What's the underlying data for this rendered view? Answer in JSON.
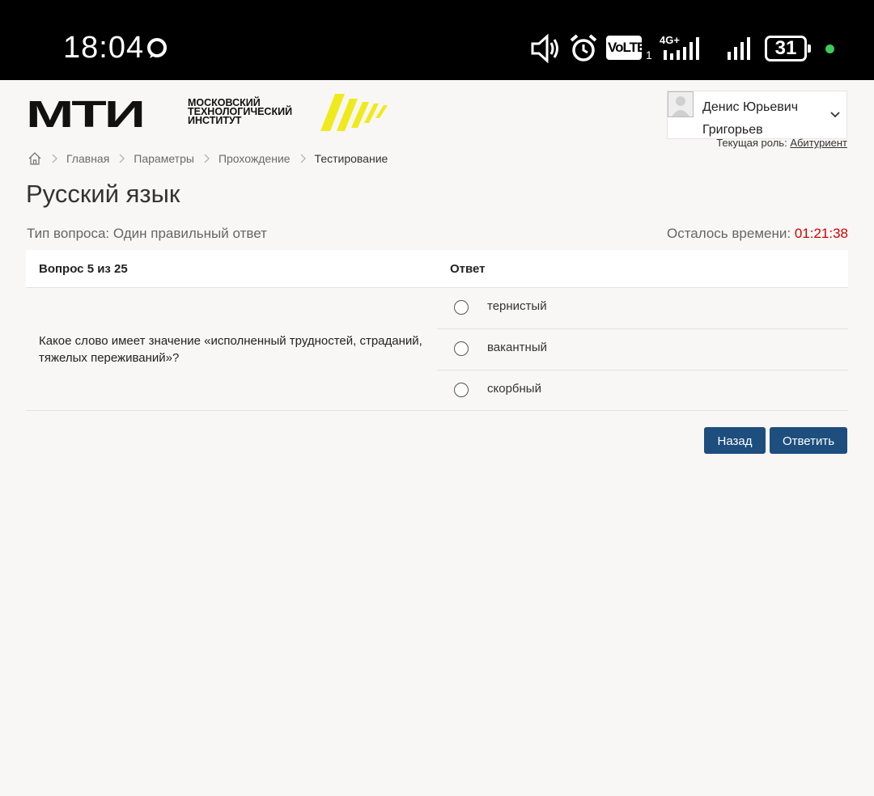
{
  "status_bar": {
    "time": "18:04",
    "volte": "VoLTE",
    "sim": "1",
    "network": "4G+",
    "battery": "31"
  },
  "header": {
    "logo_mark": "МТИ",
    "logo_lines": [
      "Московский",
      "технологический",
      "институт"
    ],
    "user_name": "Денис Юрьевич Григорьев",
    "role_label": "Текущая роль:",
    "role_value": "Абитуриент"
  },
  "breadcrumb": {
    "items": [
      "Главная",
      "Параметры",
      "Прохождение",
      "Тестирование"
    ]
  },
  "page": {
    "title": "Русский язык",
    "question_type": "Тип вопроса: Один правильный ответ",
    "time_left_label": "Осталось времени:",
    "time_left_value": "01:21:38"
  },
  "table": {
    "col_question": "Вопрос 5 из 25",
    "col_answer": "Ответ",
    "question": "Какое слово имеет значение «исполненный трудностей, страданий, тяжелых переживаний»?",
    "answers": [
      "тернистый",
      "вакантный",
      "скорбный"
    ]
  },
  "buttons": {
    "back": "Назад",
    "submit": "Ответить"
  },
  "colors": {
    "accent": "#1d4e7e",
    "timer": "#d00000",
    "logo_yellow": "#f0ea1c"
  }
}
